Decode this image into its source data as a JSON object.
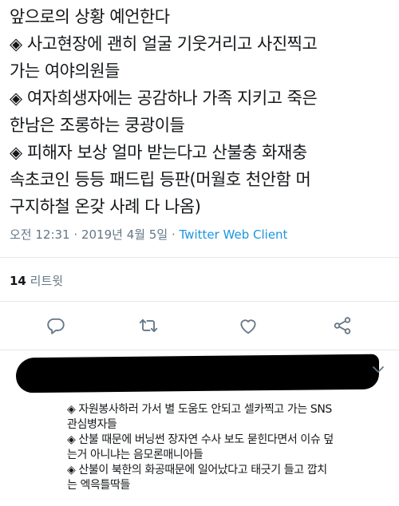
{
  "tweet": {
    "lines": [
      "앞으로의 상황 예언한다",
      "◈ 사고현장에 괜히 얼굴 기웃거리고 사진찍고",
      "가는 여야의원들",
      "◈ 여자희생자에는 공감하나 가족 지키고 죽은",
      "한남은  조롱하는 쿵광이들",
      "◈ 피해자 보상 얼마 받는다고 산불충 화재충",
      "속초코인 등등 패드립 등판(머월호 천안함 머",
      "구지하철 온갖 사례 다 나옴)"
    ],
    "time": "오전 12:31",
    "sep1": "·",
    "date": "2019년 4월 5일",
    "sep2": "·",
    "client": "Twitter Web Client"
  },
  "stats": {
    "retweet_count": "14",
    "retweet_label": "리트윗"
  },
  "reply": {
    "lines": [
      "◈ 자원봉사하러 가서 별 도움도 안되고 셀카찍고 가는 SNS",
      "관심병자들",
      "◈ 산불 때문에 버닝썬 장자연 수사 보도 묻힌다면서 이슈 덮",
      "는거 아니냐는 음모론매니아들",
      "◈ 산불이 북한의 화공때문에 일어났다고 태긋기 들고 깝치",
      "는 엑윽틀딱들"
    ]
  },
  "icons": [
    "reply-icon",
    "retweet-icon",
    "like-icon",
    "share-icon",
    "chevron-down-icon"
  ],
  "colors": {
    "text": "#14171a",
    "muted": "#657786",
    "link": "#1b95e0",
    "divider": "#e1e8ed"
  }
}
